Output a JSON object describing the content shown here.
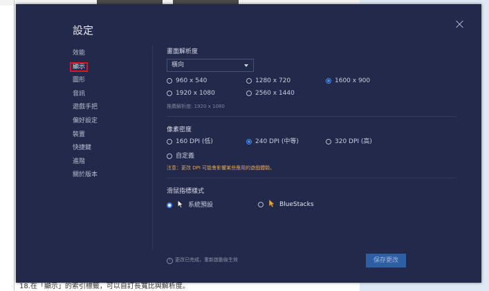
{
  "dialog": {
    "title": "設定",
    "close": "×"
  },
  "nav": {
    "items": [
      {
        "label": "效能"
      },
      {
        "label": "顯示"
      },
      {
        "label": "圖形"
      },
      {
        "label": "音訊"
      },
      {
        "label": "遊戲手把"
      },
      {
        "label": "偏好設定"
      },
      {
        "label": "裝置"
      },
      {
        "label": "快捷鍵"
      },
      {
        "label": "進階"
      },
      {
        "label": "關於版本"
      }
    ],
    "active_index": 1
  },
  "resolution": {
    "title": "畫面解析度",
    "orientation_value": "橫向",
    "options": [
      "960 x 540",
      "1280 x 720",
      "1600 x 900",
      "1920 x 1080",
      "2560 x 1440"
    ],
    "selected": "1600 x 900",
    "hint": "推薦解析度: 1920 x 1080"
  },
  "dpi": {
    "title": "像素密度",
    "options": [
      "160 DPI (低)",
      "240 DPI (中等)",
      "320 DPI (高)",
      "自定義"
    ],
    "selected": "240 DPI (中等)",
    "warning": "注意：更改 DPI 可能會影響某些應用的遊戲體驗。"
  },
  "cursor": {
    "title": "滑鼠指標樣式",
    "options": [
      "系統預設",
      "BlueStacks"
    ],
    "selected": "系統預設"
  },
  "footer": {
    "note": "更改已完成，重新啟動後生效",
    "save_label": "保存更改"
  },
  "background": {
    "caption": "18.在「顯示」的索引標籤，可以自訂長寬比與解析度。"
  },
  "colors": {
    "dialog_bg": "#23294a",
    "accent": "#3e8cf3",
    "warning": "#e0a45a",
    "highlight_box": "#e0141c"
  }
}
